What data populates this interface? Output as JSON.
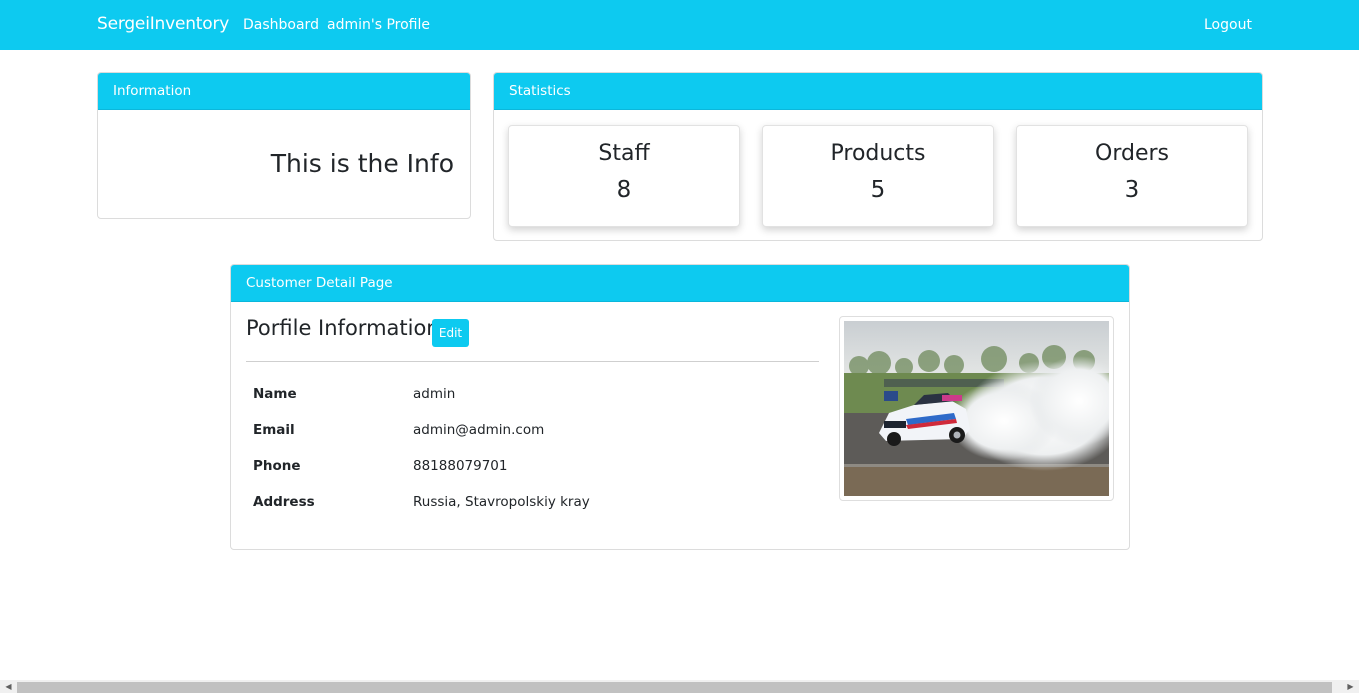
{
  "navbar": {
    "brand": "SergeiInventory",
    "links": [
      {
        "label": "Dashboard"
      },
      {
        "label": "admin's Profile"
      }
    ],
    "logout": "Logout"
  },
  "info_card": {
    "header": "Information",
    "text": "This is the Info"
  },
  "stats_card": {
    "header": "Statistics",
    "items": [
      {
        "label": "Staff",
        "value": "8"
      },
      {
        "label": "Products",
        "value": "5"
      },
      {
        "label": "Orders",
        "value": "3"
      }
    ]
  },
  "customer_card": {
    "header": "Customer Detail Page",
    "title": "Porfile Information",
    "edit_label": "Edit",
    "fields": [
      {
        "label": "Name",
        "value": "admin"
      },
      {
        "label": "Email",
        "value": "admin@admin.com"
      },
      {
        "label": "Phone",
        "value": "88188079701"
      },
      {
        "label": "Address",
        "value": "Russia, Stavropolskiy kray"
      }
    ],
    "image": "drifting-race-car-photo"
  },
  "colors": {
    "accent": "#0dcaf0",
    "text": "#212529",
    "border": "#dcdcdc"
  }
}
